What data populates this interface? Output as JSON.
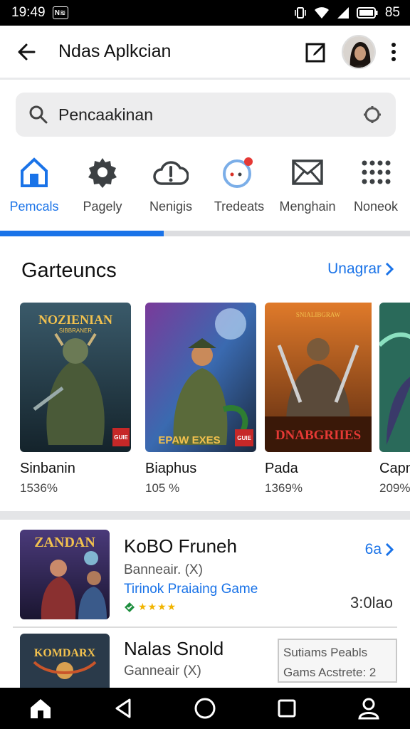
{
  "status": {
    "time": "19:49",
    "notif_badge": "N≋",
    "battery": "85"
  },
  "appbar": {
    "title": "Ndas Aplkcian"
  },
  "search": {
    "query": "Pencaakinan"
  },
  "categories": [
    {
      "label": "Pemcals",
      "icon": "home-icon",
      "active": true
    },
    {
      "label": "Pagely",
      "icon": "gear-icon",
      "active": false
    },
    {
      "label": "Nenigis",
      "icon": "alert-cloud-icon",
      "active": false
    },
    {
      "label": "Tredeats",
      "icon": "chat-bubble-icon",
      "active": false
    },
    {
      "label": "Menghain",
      "icon": "mail-icon",
      "active": false
    },
    {
      "label": "Noneok",
      "icon": "grid-icon",
      "active": false
    }
  ],
  "section": {
    "title": "Garteuncs",
    "more": "Unagrar"
  },
  "cards": [
    {
      "name": "Sinbanin",
      "pct": "1536%",
      "art_title": "NOZIENIAN",
      "art_sub": "SIBBRANER",
      "badge": "GUIE"
    },
    {
      "name": "Biaphus",
      "pct": "105 %",
      "art_title": "EPAW EXES",
      "art_sub": "",
      "badge": "GUIE"
    },
    {
      "name": "Pada",
      "pct": "1369%",
      "art_title": "DNABGRIIES",
      "art_sub": "SNIALIBGRAW",
      "badge": ""
    },
    {
      "name": "Capn",
      "pct": "209%",
      "art_title": "",
      "art_sub": "",
      "badge": ""
    }
  ],
  "list": [
    {
      "title": "KoBO Fruneh",
      "subtitle": "Banneair. (X)",
      "genre": "Tirinok Praiaing Game",
      "link": "6a",
      "time": "3:0lao",
      "art_title": "ZANDAN"
    },
    {
      "title": "Nalas Snold",
      "subtitle": "Ganneair (X)",
      "art_title": "KOMDARX"
    }
  ],
  "tooltip": {
    "line1": "Sutiams Peabls",
    "line2": "Gams Acstrete: 2"
  },
  "colors": {
    "accent": "#1a73e8",
    "star": "#f1b400",
    "verified": "#1e8e3e"
  }
}
